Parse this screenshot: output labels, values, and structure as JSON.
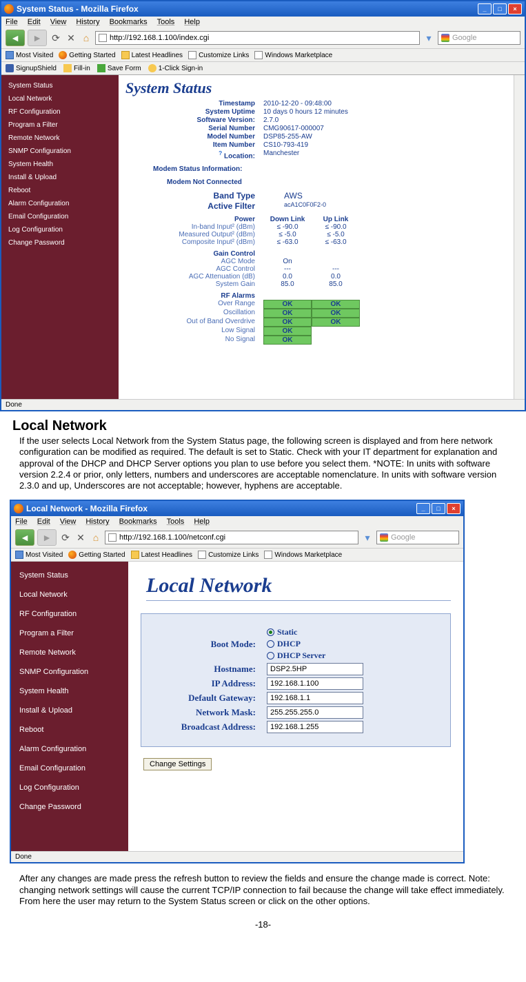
{
  "screenshot1": {
    "title": "System Status - Mozilla Firefox",
    "menus": [
      "File",
      "Edit",
      "View",
      "History",
      "Bookmarks",
      "Tools",
      "Help"
    ],
    "url": "http://192.168.1.100/index.cgi",
    "search_placeholder": "Google",
    "bookmarks1": [
      "Most Visited",
      "Getting Started",
      "Latest Headlines",
      "Customize Links",
      "Windows Marketplace"
    ],
    "bookmarks2": [
      "SignupShield",
      "Fill-in",
      "Save Form",
      "1-Click Sign-in"
    ],
    "sidebar": [
      "System Status",
      "Local Network",
      "RF Configuration",
      "Program a Filter",
      "Remote Network",
      "SNMP Configuration",
      "System Health",
      "Install & Upload",
      "Reboot",
      "Alarm Configuration",
      "Email Configuration",
      "Log Configuration",
      "Change Password"
    ],
    "page_heading": "System Status",
    "info": {
      "timestamp_l": "Timestamp",
      "timestamp_v": "2010-12-20 - 09:48:00",
      "uptime_l": "System Uptime",
      "uptime_v": "10 days 0 hours 12 minutes",
      "swver_l": "Software Version:",
      "swver_v": "2.7.0",
      "serial_l": "Serial Number",
      "serial_v": "CMG90617-000007",
      "model_l": "Model Number",
      "model_v": "DSP85-255-AW",
      "item_l": "Item Number",
      "item_v": "CS10-793-419",
      "loc_l": "Location:",
      "loc_v": "Manchester"
    },
    "modem_hdr": "Modem Status Information:",
    "modem_sub": "Modem Not Connected",
    "band_l": "Band Type",
    "band_v": "AWS",
    "filter_l": "Active Filter",
    "filter_v": "acA1C0F0F2-0",
    "power_hdr": {
      "c1": "Power",
      "c2": "Down Link",
      "c3": "Up Link"
    },
    "power_rows": [
      {
        "l": "In-band Input² (dBm)",
        "d": "≤ -90.0",
        "u": "≤ -90.0"
      },
      {
        "l": "Measured Output² (dBm)",
        "d": "≤ -5.0",
        "u": "≤ -5.0"
      },
      {
        "l": "Composite Input² (dBm)",
        "d": "≤ -63.0",
        "u": "≤ -63.0"
      }
    ],
    "gain_hdr": "Gain Control",
    "gain_rows": [
      {
        "l": "AGC Mode",
        "d": "On",
        "u": ""
      },
      {
        "l": "AGC Control",
        "d": "---",
        "u": "---"
      },
      {
        "l": "AGC Attenuation (dB)",
        "d": "0.0",
        "u": "0.0"
      },
      {
        "l": "System Gain",
        "d": "85.0",
        "u": "85.0"
      }
    ],
    "rf_hdr": "RF Alarms",
    "rf_rows": [
      {
        "l": "Over Range",
        "d": "OK",
        "u": "OK"
      },
      {
        "l": "Oscillation",
        "d": "OK",
        "u": "OK"
      },
      {
        "l": "Out of Band Overdrive",
        "d": "OK",
        "u": "OK"
      },
      {
        "l": "Low Signal",
        "d": "OK",
        "u": ""
      },
      {
        "l": "No Signal",
        "d": "OK",
        "u": ""
      }
    ],
    "status": "Done"
  },
  "doc": {
    "heading": "Local Network",
    "para1": "If the user selects Local Network from the System Status page, the following screen is displayed and from here network configuration can be modified as required. The default is set to Static. Check with your IT department for explanation and approval of the DHCP and DHCP Server options you plan to use before you select them. *NOTE:  In units with software version 2.2.4 or prior, only letters, numbers and underscores are acceptable nomenclature.  In units with software version 2.3.0 and up, Underscores are not acceptable; however, hyphens are acceptable.",
    "para2": "After any changes are made press the refresh button to review the fields and ensure the change made is correct. Note: changing network settings will cause the current TCP/IP connection to fail because the change will  take effect immediately. From here the user may return to the System Status screen or click on the other options.",
    "page": "-18-"
  },
  "screenshot2": {
    "title": "Local Network - Mozilla Firefox",
    "menus": [
      "File",
      "Edit",
      "View",
      "History",
      "Bookmarks",
      "Tools",
      "Help"
    ],
    "url": "http://192.168.1.100/netconf.cgi",
    "search_placeholder": "Google",
    "bookmarks1": [
      "Most Visited",
      "Getting Started",
      "Latest Headlines",
      "Customize Links",
      "Windows Marketplace"
    ],
    "sidebar": [
      "System Status",
      "Local Network",
      "RF Configuration",
      "Program a Filter",
      "Remote Network",
      "SNMP Configuration",
      "System Health",
      "Install & Upload",
      "Reboot",
      "Alarm Configuration",
      "Email Configuration",
      "Log Configuration",
      "Change Password"
    ],
    "page_heading": "Local Network",
    "boot_label": "Boot Mode:",
    "boot_opts": [
      "Static",
      "DHCP",
      "DHCP Server"
    ],
    "fields": [
      {
        "l": "Hostname:",
        "v": "DSP2.5HP"
      },
      {
        "l": "IP Address:",
        "v": "192.168.1.100"
      },
      {
        "l": "Default Gateway:",
        "v": "192.168.1.1"
      },
      {
        "l": "Network Mask:",
        "v": "255.255.255.0"
      },
      {
        "l": "Broadcast Address:",
        "v": "192.168.1.255"
      }
    ],
    "button": "Change Settings",
    "status": "Done"
  }
}
